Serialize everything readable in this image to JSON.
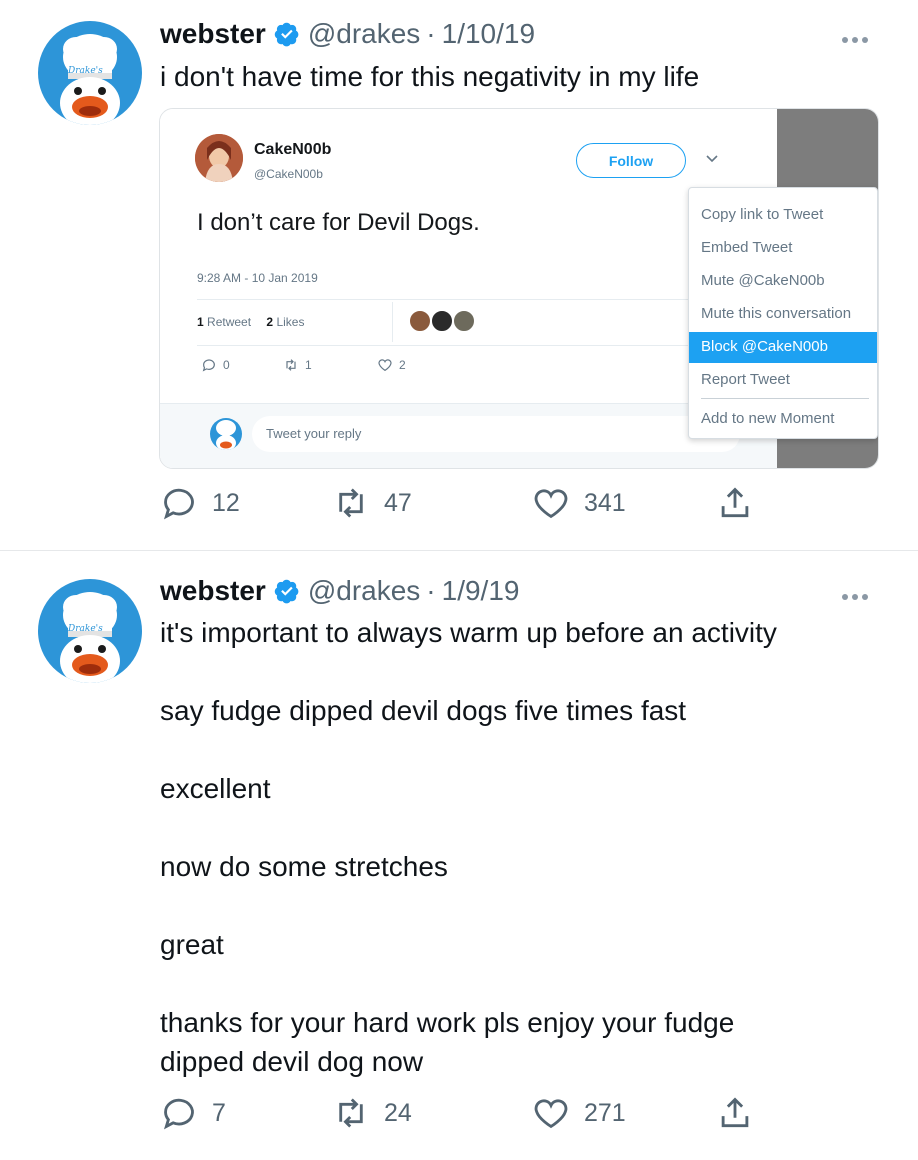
{
  "colors": {
    "accent": "#1da1f2",
    "verified": "#1d9bf0",
    "text_primary": "#0f1419",
    "text_secondary": "#536471"
  },
  "tweets": [
    {
      "name": "webster",
      "handle": "@drakes",
      "separator": "·",
      "date": "1/10/19",
      "avatar_label": "Drake's",
      "text": [
        "i don't have time for this negativity in my life"
      ],
      "replies": "12",
      "retweets": "47",
      "likes": "341",
      "embedded": {
        "name": "CakeN00b",
        "handle": "@CakeN00b",
        "follow_label": "Follow",
        "text": "I don’t care for Devil Dogs.",
        "timestamp": "9:28 AM - 10 Jan 2019",
        "retweet_count": "1",
        "retweet_label": "Retweet",
        "like_count": "2",
        "like_label": "Likes",
        "action_replies": "0",
        "action_retweets": "1",
        "action_likes": "2",
        "reply_placeholder": "Tweet your reply",
        "menu": [
          "Copy link to Tweet",
          "Embed Tweet",
          "Mute @CakeN00b",
          "Mute this conversation",
          "Block @CakeN00b",
          "Report Tweet",
          "Add to new Moment"
        ],
        "menu_highlighted": "Block @CakeN00b"
      }
    },
    {
      "name": "webster",
      "handle": "@drakes",
      "separator": "·",
      "date": "1/9/19",
      "avatar_label": "Drake's",
      "text": [
        "it's important to always warm up before an activity",
        "say fudge dipped devil dogs five times fast",
        "excellent",
        "now do some stretches",
        "great",
        "thanks for your hard work pls enjoy your fudge dipped devil dog now"
      ],
      "replies": "7",
      "retweets": "24",
      "likes": "271"
    }
  ]
}
